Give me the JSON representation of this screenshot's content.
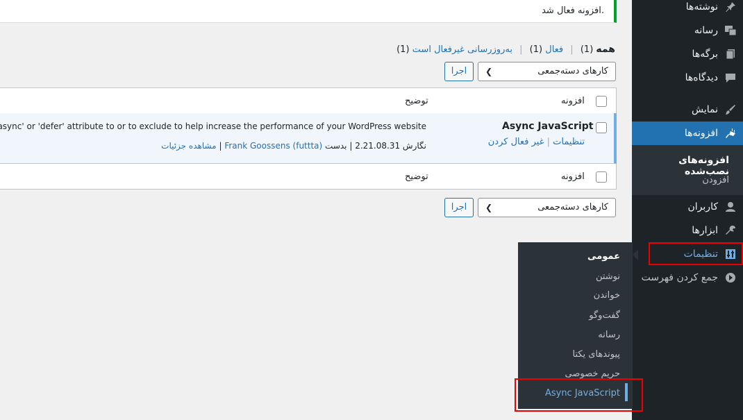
{
  "notice": {
    "text": "افزونه فعال شد."
  },
  "filters": {
    "all_label": "همه",
    "all_count": "(1)",
    "active_label": "فعال",
    "active_count": "(1)",
    "autoupdate_label": "به‌روزرسانی غیرفعال است",
    "autoupdate_count": "(1)"
  },
  "bulk": {
    "select_label": "کارهای دسته‌جمعی",
    "apply_label": "اجرا"
  },
  "table": {
    "col_plugin": "افزونه",
    "col_description": "توضیح",
    "rows": [
      {
        "name": "Async JavaScript",
        "action_settings": "تنظیمات",
        "action_deactivate": "غیر فعال کردن",
        "description": "dd a 'async' or 'defer' attribute to or to exclude to help increase the performance of your WordPress website",
        "version_label": "نگارش",
        "version": "2.21.08.31",
        "by_label": "بدست",
        "author": "Frank Goossens (futtta)",
        "details_link": "مشاهده جزئیات"
      }
    ]
  },
  "sidebar": {
    "items": [
      {
        "label": "نوشته‌ها",
        "icon": "pin-icon"
      },
      {
        "label": "رسانه",
        "icon": "media-icon"
      },
      {
        "label": "برگه‌ها",
        "icon": "pages-icon"
      },
      {
        "label": "دیدگاه‌ها",
        "icon": "comment-icon"
      },
      {
        "label": "نمایش",
        "icon": "brush-icon"
      },
      {
        "label": "افزونه‌ها",
        "icon": "plugin-icon"
      },
      {
        "label": "کاربران",
        "icon": "user-icon"
      },
      {
        "label": "ابزارها",
        "icon": "wrench-icon"
      },
      {
        "label": "تنظیمات",
        "icon": "settings-icon"
      },
      {
        "label": "جمع کردن فهرست",
        "icon": "collapse-icon"
      }
    ],
    "plugins_sub": {
      "installed": "افزونه‌های نصب‌شده",
      "add": "افزودن"
    }
  },
  "flyout": {
    "items": [
      "عمومی",
      "نوشتن",
      "خواندن",
      "گفت‌وگو",
      "رسانه",
      "پیوندهای یکتا",
      "حریم خصوصی",
      "Async JavaScript"
    ]
  },
  "colors": {
    "accent": "#2271b1",
    "sidebar_bg": "#1d2327",
    "highlight": "#e00000",
    "success": "#00a32a"
  }
}
